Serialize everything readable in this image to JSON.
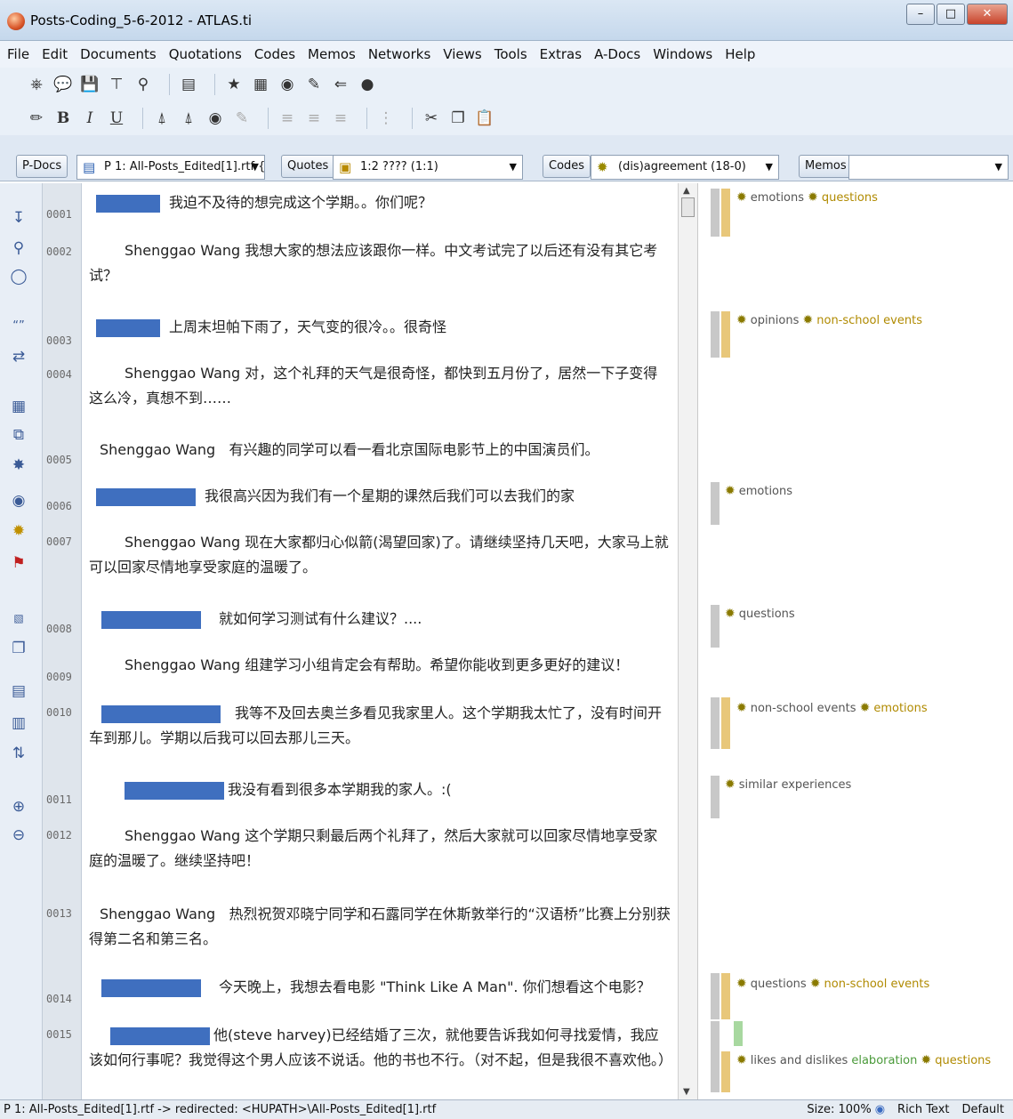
{
  "window": {
    "title": "Posts-Coding_5-6-2012 - ATLAS.ti"
  },
  "menu": [
    "File",
    "Edit",
    "Documents",
    "Quotations",
    "Codes",
    "Memos",
    "Networks",
    "Views",
    "Tools",
    "Extras",
    "A-Docs",
    "Windows",
    "Help"
  ],
  "docbar": {
    "pdocs_label": "P-Docs",
    "pdoc_value": "P 1: All-Posts_Edited[1].rtf {",
    "quotes_label": "Quotes",
    "quote_value": "1:2 ???? (1:1)",
    "codes_label": "Codes",
    "code_value": "(dis)agreement (18-0)",
    "memos_label": "Memos",
    "memo_value": ""
  },
  "lines": [
    "0001",
    "0002",
    "0003",
    "0004",
    "0005",
    "0006",
    "0007",
    "0008",
    "0009",
    "0010",
    "0011",
    "0012",
    "0013",
    "0014",
    "0015"
  ],
  "paragraphs": [
    {
      "name": "",
      "text": "我迫不及待的想完成这个学期。。你们呢？"
    },
    {
      "name": "Shenggao Wang",
      "text": "我想大家的想法应该跟你一样。中文考试完了以后还有没有其它考试？"
    },
    {
      "name": "",
      "text": "上周末坦帕下雨了，天气变的很冷。。很奇怪"
    },
    {
      "name": "Shenggao Wang",
      "text": "对，这个礼拜的天气是很奇怪，都快到五月份了，居然一下子变得这么冷，真想不到……"
    },
    {
      "name": "Shenggao Wang",
      "text": "有兴趣的同学可以看一看北京国际电影节上的中国演员们。"
    },
    {
      "name": "",
      "text": "我很高兴因为我们有一个星期的课然后我们可以去我们的家"
    },
    {
      "name": "Shenggao Wang",
      "text": "现在大家都归心似箭(渴望回家)了。请继续坚持几天吧，大家马上就可以回家尽情地享受家庭的温暖了。"
    },
    {
      "name": "",
      "text": "就如何学习测试有什么建议？...."
    },
    {
      "name": "Shenggao Wang",
      "text": "组建学习小组肯定会有帮助。希望你能收到更多更好的建议！"
    },
    {
      "name": "",
      "text": "我等不及回去奥兰多看见我家里人。这个学期我太忙了，没有时间开车到那儿。学期以后我可以回去那儿三天。"
    },
    {
      "name": "",
      "text": "我没有看到很多本学期我的家人。:("
    },
    {
      "name": "Shenggao Wang",
      "text": "这个学期只剩最后两个礼拜了，然后大家就可以回家尽情地享受家庭的温暖了。继续坚持吧！"
    },
    {
      "name": "Shenggao Wang",
      "text": "热烈祝贺邓晓宁同学和石露同学在休斯敦举行的“汉语桥”比赛上分别获得第二名和第三名。"
    },
    {
      "name": "",
      "text": "今天晚上，我想去看电影 \"Think Like A Man\". 你们想看这个电影？"
    },
    {
      "name": "",
      "text": "他(steve harvey)已经结婚了三次，就他要告诉我如何寻找爱情，我应该如何行事呢？我觉得这个男人应该不说话。他的书也不行。（对不起，但是我很不喜欢他。）"
    }
  ],
  "margin_codes": [
    {
      "items": [
        {
          "label": "emotions",
          "color": "#555555"
        },
        {
          "label": "questions",
          "color": "#b08a00"
        }
      ]
    },
    {
      "items": [
        {
          "label": "opinions",
          "color": "#555555"
        },
        {
          "label": "non-school events",
          "color": "#b08a00"
        }
      ]
    },
    {
      "items": [
        {
          "label": "emotions",
          "color": "#555555"
        }
      ]
    },
    {
      "items": [
        {
          "label": "questions",
          "color": "#555555"
        }
      ]
    },
    {
      "items": [
        {
          "label": "non-school events",
          "color": "#555555"
        },
        {
          "label": "emotions",
          "color": "#b08a00"
        }
      ]
    },
    {
      "items": [
        {
          "label": "similar experiences",
          "color": "#555555"
        }
      ]
    },
    {
      "items": [
        {
          "label": "questions",
          "color": "#555555"
        },
        {
          "label": "non-school events",
          "color": "#b08a00"
        }
      ]
    },
    {
      "items": [
        {
          "label": "likes and dislikes",
          "color": "#555555"
        },
        {
          "label": "elaboration",
          "color": "#4a9a3a"
        },
        {
          "label": "questions",
          "color": "#b08a00"
        }
      ]
    }
  ],
  "statusbar": {
    "path": "P 1: All-Posts_Edited[1].rtf -> redirected: <HUPATH>\\All-Posts_Edited[1].rtf",
    "size": "Size: 100%",
    "format": "Rich Text",
    "mode": "Default"
  },
  "colors": {
    "code_bar_gray": "#c8c8c8",
    "code_bar_gold": "#e8c77a",
    "code_bar_green": "#a8d8a0",
    "redaction": "#3f6fbf"
  }
}
